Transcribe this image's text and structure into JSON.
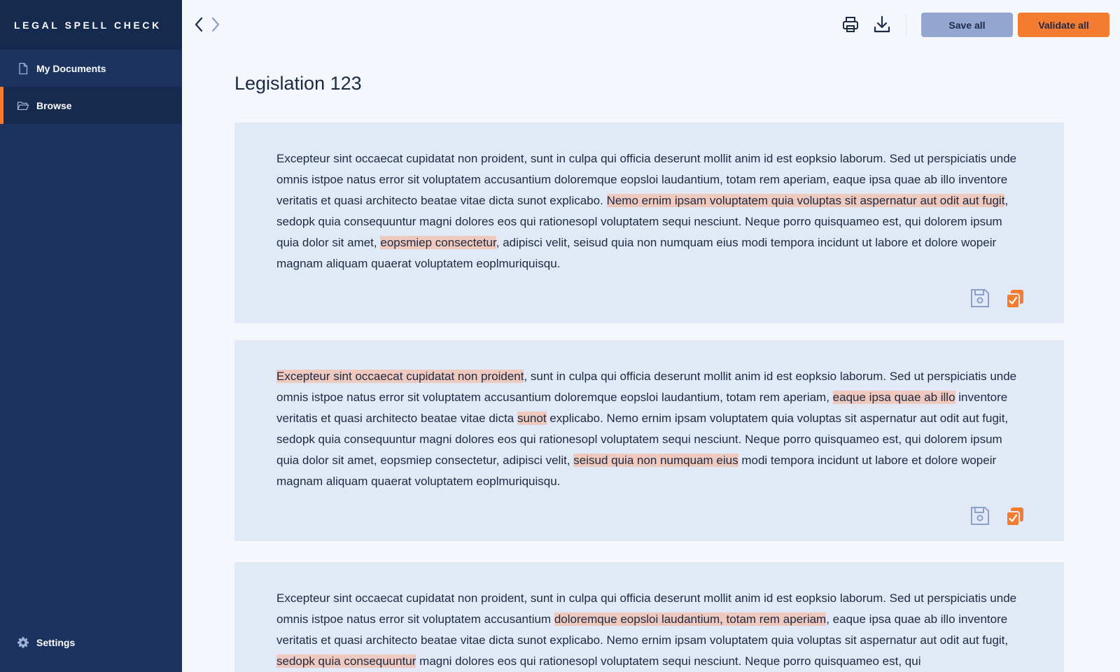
{
  "app": {
    "title": "LEGAL SPELL CHECK"
  },
  "sidebar": {
    "items": [
      {
        "label": "My Documents",
        "icon": "document-icon",
        "active": false
      },
      {
        "label": "Browse",
        "icon": "folder-open-icon",
        "active": true
      }
    ],
    "settings_label": "Settings"
  },
  "toolbar": {
    "save_all": "Save all",
    "validate_all": "Validate all"
  },
  "document": {
    "title": "Legislation 123",
    "paragraphs": [
      {
        "segments": [
          {
            "text": "Excepteur sint occaecat cupidatat non proident, sunt in culpa qui officia deserunt mollit anim id est eopksio laborum. Sed ut perspiciatis unde omnis istpoe natus error sit voluptatem accusantium doloremque eopsloi laudantium, totam rem aperiam, eaque ipsa quae ab illo inventore veritatis et quasi architecto beatae vitae dicta sunot explicabo. ",
            "hl": false
          },
          {
            "text": "Nemo ernim ipsam voluptatem quia voluptas sit aspernatur aut odit aut fugit",
            "hl": true
          },
          {
            "text": ", sedopk quia consequuntur magni dolores eos qui rationesopl voluptatem sequi nesciunt. Neque porro quisquameo est, qui dolorem ipsum quia dolor sit amet, ",
            "hl": false
          },
          {
            "text": "eopsmiep consectetur",
            "hl": true
          },
          {
            "text": ", adipisci velit, seisud quia non numquam eius modi tempora incidunt ut labore et dolore wopeir magnam aliquam quaerat voluptatem eoplmuriquisqu.",
            "hl": false
          }
        ]
      },
      {
        "segments": [
          {
            "text": "Excepteur sint occaecat cupidatat non proident",
            "hl": true
          },
          {
            "text": ", sunt in culpa qui officia deserunt mollit anim id est eopksio laborum. Sed ut perspiciatis unde omnis istpoe natus error sit voluptatem accusantium doloremque eopsloi laudantium, totam rem aperiam, ",
            "hl": false
          },
          {
            "text": "eaque ipsa quae ab illo",
            "hl": true
          },
          {
            "text": " inventore veritatis et quasi architecto beatae vitae dicta ",
            "hl": false
          },
          {
            "text": "sunot",
            "hl": true
          },
          {
            "text": " explicabo. Nemo ernim ipsam voluptatem quia voluptas sit aspernatur aut odit aut fugit, sedopk quia consequuntur magni dolores eos qui rationesopl voluptatem sequi nesciunt. Neque porro quisquameo est, qui dolorem ipsum quia dolor sit amet, eopsmiep consectetur, adipisci velit, ",
            "hl": false
          },
          {
            "text": "seisud quia non numquam eius",
            "hl": true
          },
          {
            "text": " modi tempora incidunt ut labore et dolore wopeir magnam aliquam quaerat voluptatem eoplmuriquisqu.",
            "hl": false
          }
        ]
      },
      {
        "segments": [
          {
            "text": "Excepteur sint occaecat cupidatat non proident, sunt in culpa qui officia deserunt mollit anim id est eopksio laborum. Sed ut perspiciatis unde omnis istpoe natus error sit voluptatem accusantium ",
            "hl": false
          },
          {
            "text": "doloremque eopsloi laudantium, totam rem aperiam",
            "hl": true
          },
          {
            "text": ", eaque ipsa quae ab illo inventore veritatis et quasi architecto beatae vitae dicta sunot explicabo. Nemo ernim ipsam voluptatem quia voluptas sit aspernatur aut odit aut fugit, ",
            "hl": false
          },
          {
            "text": "sedopk quia consequuntur",
            "hl": true
          },
          {
            "text": " magni dolores eos qui rationesopl voluptatem sequi nesciunt. Neque porro quisquameo est, qui",
            "hl": false
          }
        ]
      }
    ]
  },
  "colors": {
    "sidebar_bg": "#1b335e",
    "sidebar_header_bg": "#162a4e",
    "accent_orange": "#f47c30",
    "save_button": "#93a6cf",
    "card_bg": "#e1e9f6",
    "highlight": "#efc9bd",
    "page_bg": "#f4f7fc"
  }
}
